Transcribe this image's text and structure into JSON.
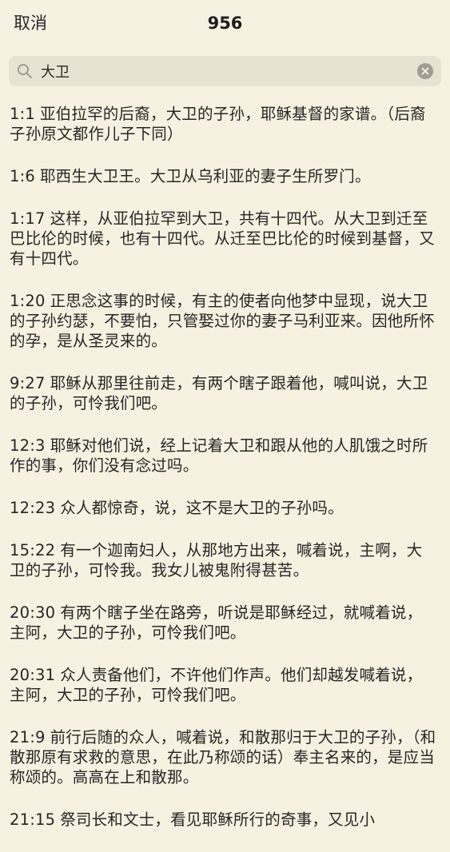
{
  "header": {
    "cancel_label": "取消",
    "title": "956"
  },
  "search": {
    "value": "大卫"
  },
  "results": [
    {
      "ref": "1:1",
      "text": "亚伯拉罕的后裔，大卫的子孙，耶稣基督的家谱。（后裔子孙原文都作儿子下同）"
    },
    {
      "ref": "1:6",
      "text": "耶西生大卫王。大卫从乌利亚的妻子生所罗门。"
    },
    {
      "ref": "1:17",
      "text": "这样，从亚伯拉罕到大卫，共有十四代。从大卫到迁至巴比伦的时候，也有十四代。从迁至巴比伦的时候到基督，又有十四代。"
    },
    {
      "ref": "1:20",
      "text": "正思念这事的时候，有主的使者向他梦中显现，说大卫的子孙约瑟，不要怕，只管娶过你的妻子马利亚来。因他所怀的孕，是从圣灵来的。"
    },
    {
      "ref": "9:27",
      "text": "耶稣从那里往前走，有两个瞎子跟着他，喊叫说，大卫的子孙，可怜我们吧。"
    },
    {
      "ref": "12:3",
      "text": "耶稣对他们说，经上记着大卫和跟从他的人肌饿之时所作的事，你们没有念过吗。"
    },
    {
      "ref": "12:23",
      "text": "众人都惊奇，说，这不是大卫的子孙吗。"
    },
    {
      "ref": "15:22",
      "text": "有一个迦南妇人，从那地方出来，喊着说，主啊，大卫的子孙，可怜我。我女儿被鬼附得甚苦。"
    },
    {
      "ref": "20:30",
      "text": "有两个瞎子坐在路旁，听说是耶稣经过，就喊着说，主阿，大卫的子孙，可怜我们吧。"
    },
    {
      "ref": "20:31",
      "text": "众人责备他们，不许他们作声。他们却越发喊着说，主阿，大卫的子孙，可怜我们吧。"
    },
    {
      "ref": "21:9",
      "text": "前行后随的众人，喊着说，和散那归于大卫的子孙，（和散那原有求救的意思，在此乃称颂的话）奉主名来的，是应当称颂的。高高在上和散那。"
    },
    {
      "ref": "21:15",
      "text": "祭司长和文士，看见耶稣所行的奇事，又见小"
    }
  ]
}
